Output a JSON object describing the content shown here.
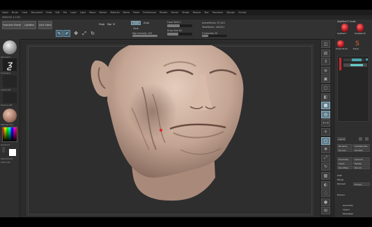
{
  "menubar": {
    "items": [
      "Alpha",
      "Brush",
      "Color",
      "Document",
      "Draw",
      "Edit",
      "File",
      "Layer",
      "Light",
      "Macro",
      "Marker",
      "Material",
      "Movie",
      "Picker",
      "Preferences",
      "Render",
      "Stencil",
      "Stroke",
      "Texture",
      "Tool",
      "Transform",
      "Zplugin",
      "Zscript"
    ]
  },
  "app_title": "ZBRUSH 4.0 R2",
  "toolbar": {
    "projection_master": "Projection Master",
    "lightbox": "LightBox",
    "quick_sketch": "Quick Sketch",
    "mode_edit": "Edit",
    "mode_draw": "Draw",
    "mode_move": "Move",
    "mode_scale": "Scale",
    "mode_rotate": "Rotate",
    "mrgb": "Mrgb",
    "rgb": "Rgb",
    "m": "M",
    "zadd": "Zadd",
    "zsub": "Zsub",
    "zcut": "Zcut",
    "focal_shift_label": "Focal Shift",
    "focal_shift_value": "0",
    "draw_size_label": "Draw Size",
    "draw_size_value": "64",
    "active_points": "ActivePoints: 97,423",
    "total_points": "TotalPoints: 146,811",
    "rgb_intensity_label": "Rgb Intensity",
    "rgb_intensity_value": "100",
    "z_intensity_label": "Z Intensity",
    "z_intensity_value": "25",
    "focal_shift_fill": 0.5,
    "draw_size_fill": 0.45,
    "rgb_intensity_fill": 1.0,
    "z_intensity_fill": 0.25
  },
  "lefttray": {
    "brush_label": "Standard",
    "stroke_label": "FreeHand",
    "alpha_label": "Alpha Off",
    "texture_label": "Texture Off",
    "material_label": "MatCap Red",
    "gradient_label": "Gradient",
    "switch_color_label": "SwitchColor",
    "alternate_label": "Alternate"
  },
  "righticons": {
    "items": [
      {
        "name": "bpr",
        "icon": "◫"
      },
      {
        "name": "spix",
        "icon": "▤"
      },
      {
        "name": "scroll",
        "icon": "⇕"
      },
      {
        "name": "zoom",
        "icon": "⊕"
      },
      {
        "name": "actual",
        "icon": "▣"
      },
      {
        "name": "aahalf",
        "icon": "▢"
      },
      {
        "name": "persp",
        "icon": "◧"
      },
      {
        "name": "floor",
        "icon": "▦"
      },
      {
        "name": "local",
        "icon": "◎"
      },
      {
        "name": "lsym",
        "icon": "⟷"
      },
      {
        "name": "xyz",
        "icon": "✛"
      },
      {
        "name": "frame",
        "icon": "◻"
      },
      {
        "name": "move",
        "icon": "✥"
      },
      {
        "name": "scale",
        "icon": "⤢"
      },
      {
        "name": "rotate",
        "icon": "↻"
      },
      {
        "name": "polyf",
        "icon": "▩"
      },
      {
        "name": "transp",
        "icon": "◐"
      },
      {
        "name": "ghost",
        "icon": "◌"
      },
      {
        "name": "solo",
        "icon": "●"
      },
      {
        "name": "xpose",
        "icon": "⊞"
      }
    ]
  },
  "rightpanel": {
    "tool_title": "DigiMeerT: Scale",
    "tool_name_1": "DigiMeerT",
    "tool_name_2": "PolyMesh3D",
    "tool_name_3": "Simple Brush",
    "tool_name_4": "Eraser",
    "subtool_label": "SubTool",
    "layers_label": "Layers",
    "list_all": "List All",
    "new_folder": "New Folder",
    "rename": "Rename",
    "auto_reorder": "AutoReorder",
    "all_low": "All Low",
    "all_high": "All High",
    "copy": "Copy",
    "paste": "Paste",
    "duplicate": "Duplicate",
    "append": "Append",
    "insert": "Insert",
    "delete": "Delete",
    "del_other": "Del Other",
    "del_all": "Del All",
    "split": "Split",
    "merge": "Merge",
    "remesh": "Remesh",
    "project": "Project",
    "extract": "Extract",
    "geometry": "Geometry",
    "layers": "Layers",
    "fibermesh": "FiberMesh",
    "geometry_hd": "Geometry HD"
  }
}
